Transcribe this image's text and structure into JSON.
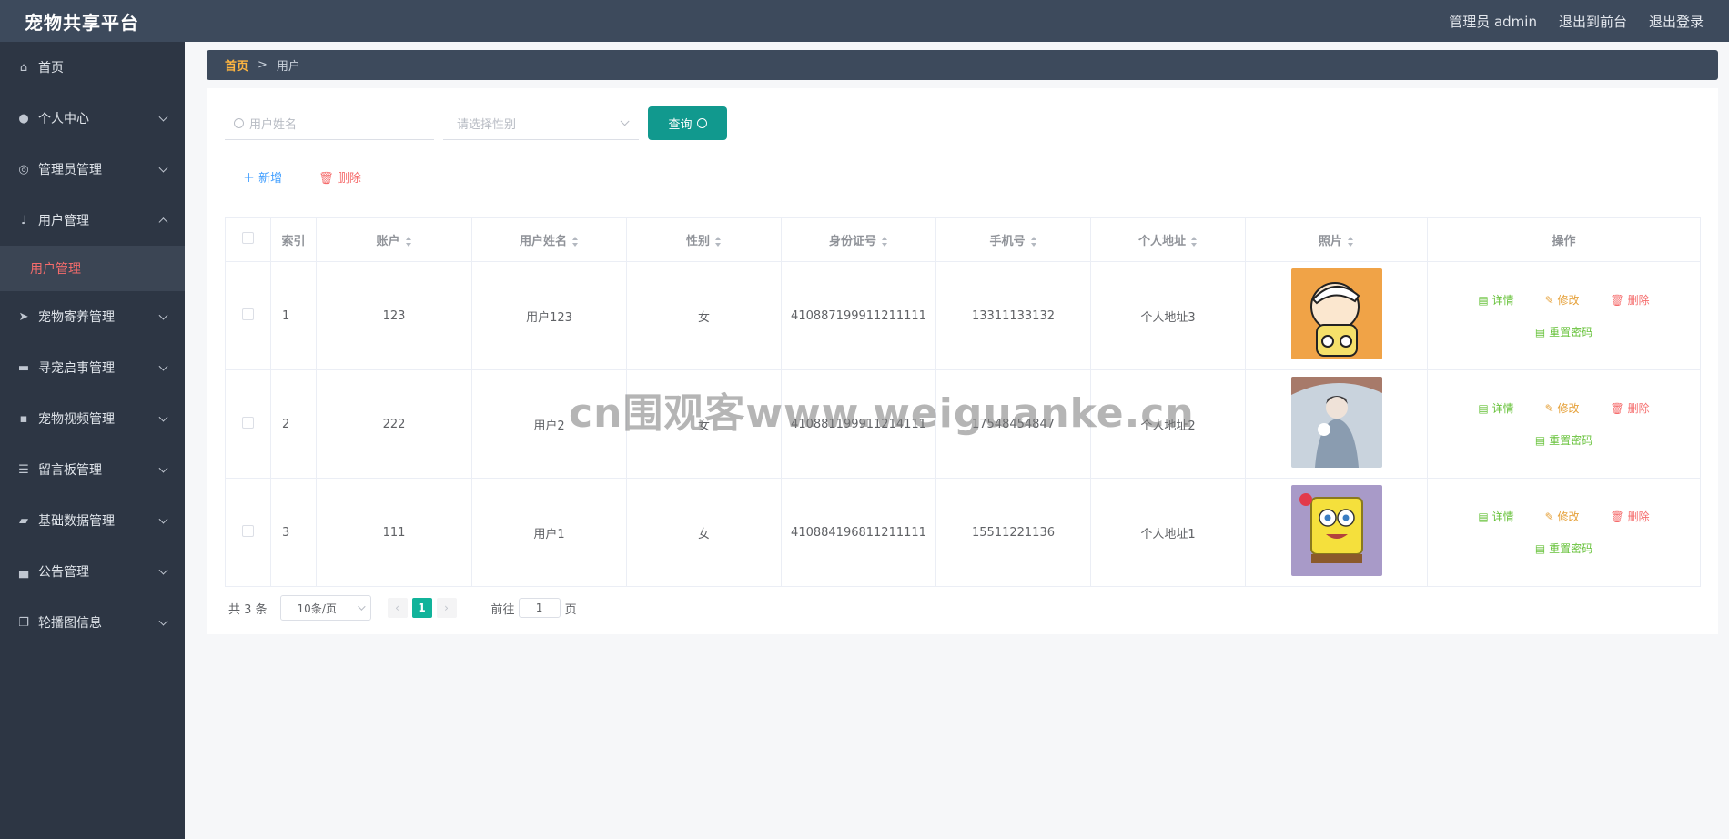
{
  "header": {
    "brand": "宠物共享平台",
    "admin": "管理员 admin",
    "to_front": "退出到前台",
    "logout": "退出登录"
  },
  "sidebar": {
    "items": [
      {
        "label": "首页",
        "icon": "home-icon"
      },
      {
        "label": "个人中心",
        "icon": "user-icon"
      },
      {
        "label": "管理员管理",
        "icon": "target-icon"
      },
      {
        "label": "用户管理",
        "icon": "mic-icon",
        "expanded": true
      },
      {
        "label": "宠物寄养管理",
        "icon": "send-icon"
      },
      {
        "label": "寻宠启事管理",
        "icon": "seat-icon"
      },
      {
        "label": "宠物视频管理",
        "icon": "chat-icon"
      },
      {
        "label": "留言板管理",
        "icon": "list-icon"
      },
      {
        "label": "基础数据管理",
        "icon": "truck-icon"
      },
      {
        "label": "公告管理",
        "icon": "notice-icon"
      },
      {
        "label": "轮播图信息",
        "icon": "copy-icon"
      }
    ],
    "active_sub": "用户管理"
  },
  "breadcrumb": {
    "home": "首页",
    "sep": ">",
    "current": "用户"
  },
  "search": {
    "name_placeholder": "用户姓名",
    "gender_placeholder": "请选择性别",
    "query_label": "查询"
  },
  "actions": {
    "add": "新增",
    "delete": "删除"
  },
  "table": {
    "headers": [
      "索引",
      "账户",
      "用户姓名",
      "性别",
      "身份证号",
      "手机号",
      "个人地址",
      "照片",
      "操作"
    ],
    "rows": [
      {
        "index": "1",
        "account": "123",
        "name": "用户123",
        "gender": "女",
        "idcard": "410887199911211111",
        "phone": "13311133132",
        "address": "个人地址3"
      },
      {
        "index": "2",
        "account": "222",
        "name": "用户2",
        "gender": "女",
        "idcard": "410881199911214111",
        "phone": "17548454847",
        "address": "个人地址2"
      },
      {
        "index": "3",
        "account": "111",
        "name": "用户1",
        "gender": "女",
        "idcard": "410884196811211111",
        "phone": "15511221136",
        "address": "个人地址1"
      }
    ],
    "ops": {
      "detail": "详情",
      "edit": "修改",
      "del": "删除",
      "reset": "重置密码"
    }
  },
  "pager": {
    "total": "共 3 条",
    "size": "10条/页",
    "current": "1",
    "goto_label": "前往",
    "goto_value": "1",
    "page_unit": "页"
  },
  "watermark": "cn围观客www.weiguanke.cn",
  "colors": {
    "header": "#3d4a5c",
    "sidebar": "#2d3644",
    "accent": "#11998e",
    "danger": "#f56c6c",
    "success": "#67c23a",
    "warning": "#e6a23c"
  }
}
